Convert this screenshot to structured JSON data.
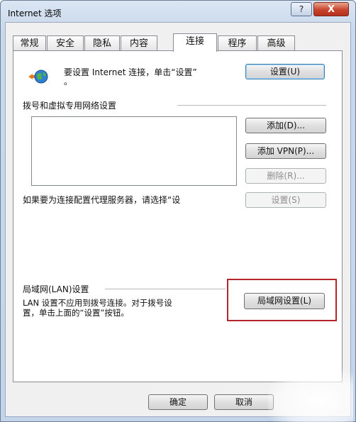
{
  "window": {
    "title": "Internet 选项",
    "help_label": "?",
    "close_label": "X"
  },
  "tabs": [
    {
      "label": "常规"
    },
    {
      "label": "安全"
    },
    {
      "label": "隐私"
    },
    {
      "label": "内容"
    },
    {
      "label": "连接"
    },
    {
      "label": "程序"
    },
    {
      "label": "高级"
    }
  ],
  "active_tab": "连接",
  "setup": {
    "text": "要设置 Internet 连接，单击“设置”",
    "text_cont": "。",
    "button": "设置(U)"
  },
  "dialup": {
    "heading": "拨号和虚拟专用网络设置",
    "add_button": "添加(D)...",
    "add_vpn_button": "添加 VPN(P)...",
    "remove_button": "删除(R)...",
    "settings_button": "设置(S)",
    "proxy_text": "如果要为连接配置代理服务器，请选择“设"
  },
  "lan": {
    "heading": "局域网(LAN)设置",
    "desc_line1": "LAN 设置不应用到拨号连接。对于拨号设",
    "desc_line2": "置，单击上面的“设置”按钮。",
    "button": "局域网设置(L)"
  },
  "footer": {
    "ok_button": "确定",
    "cancel_button": "取消"
  },
  "colors": {
    "highlight": "#b5262a",
    "close_button": "#c7432c"
  }
}
